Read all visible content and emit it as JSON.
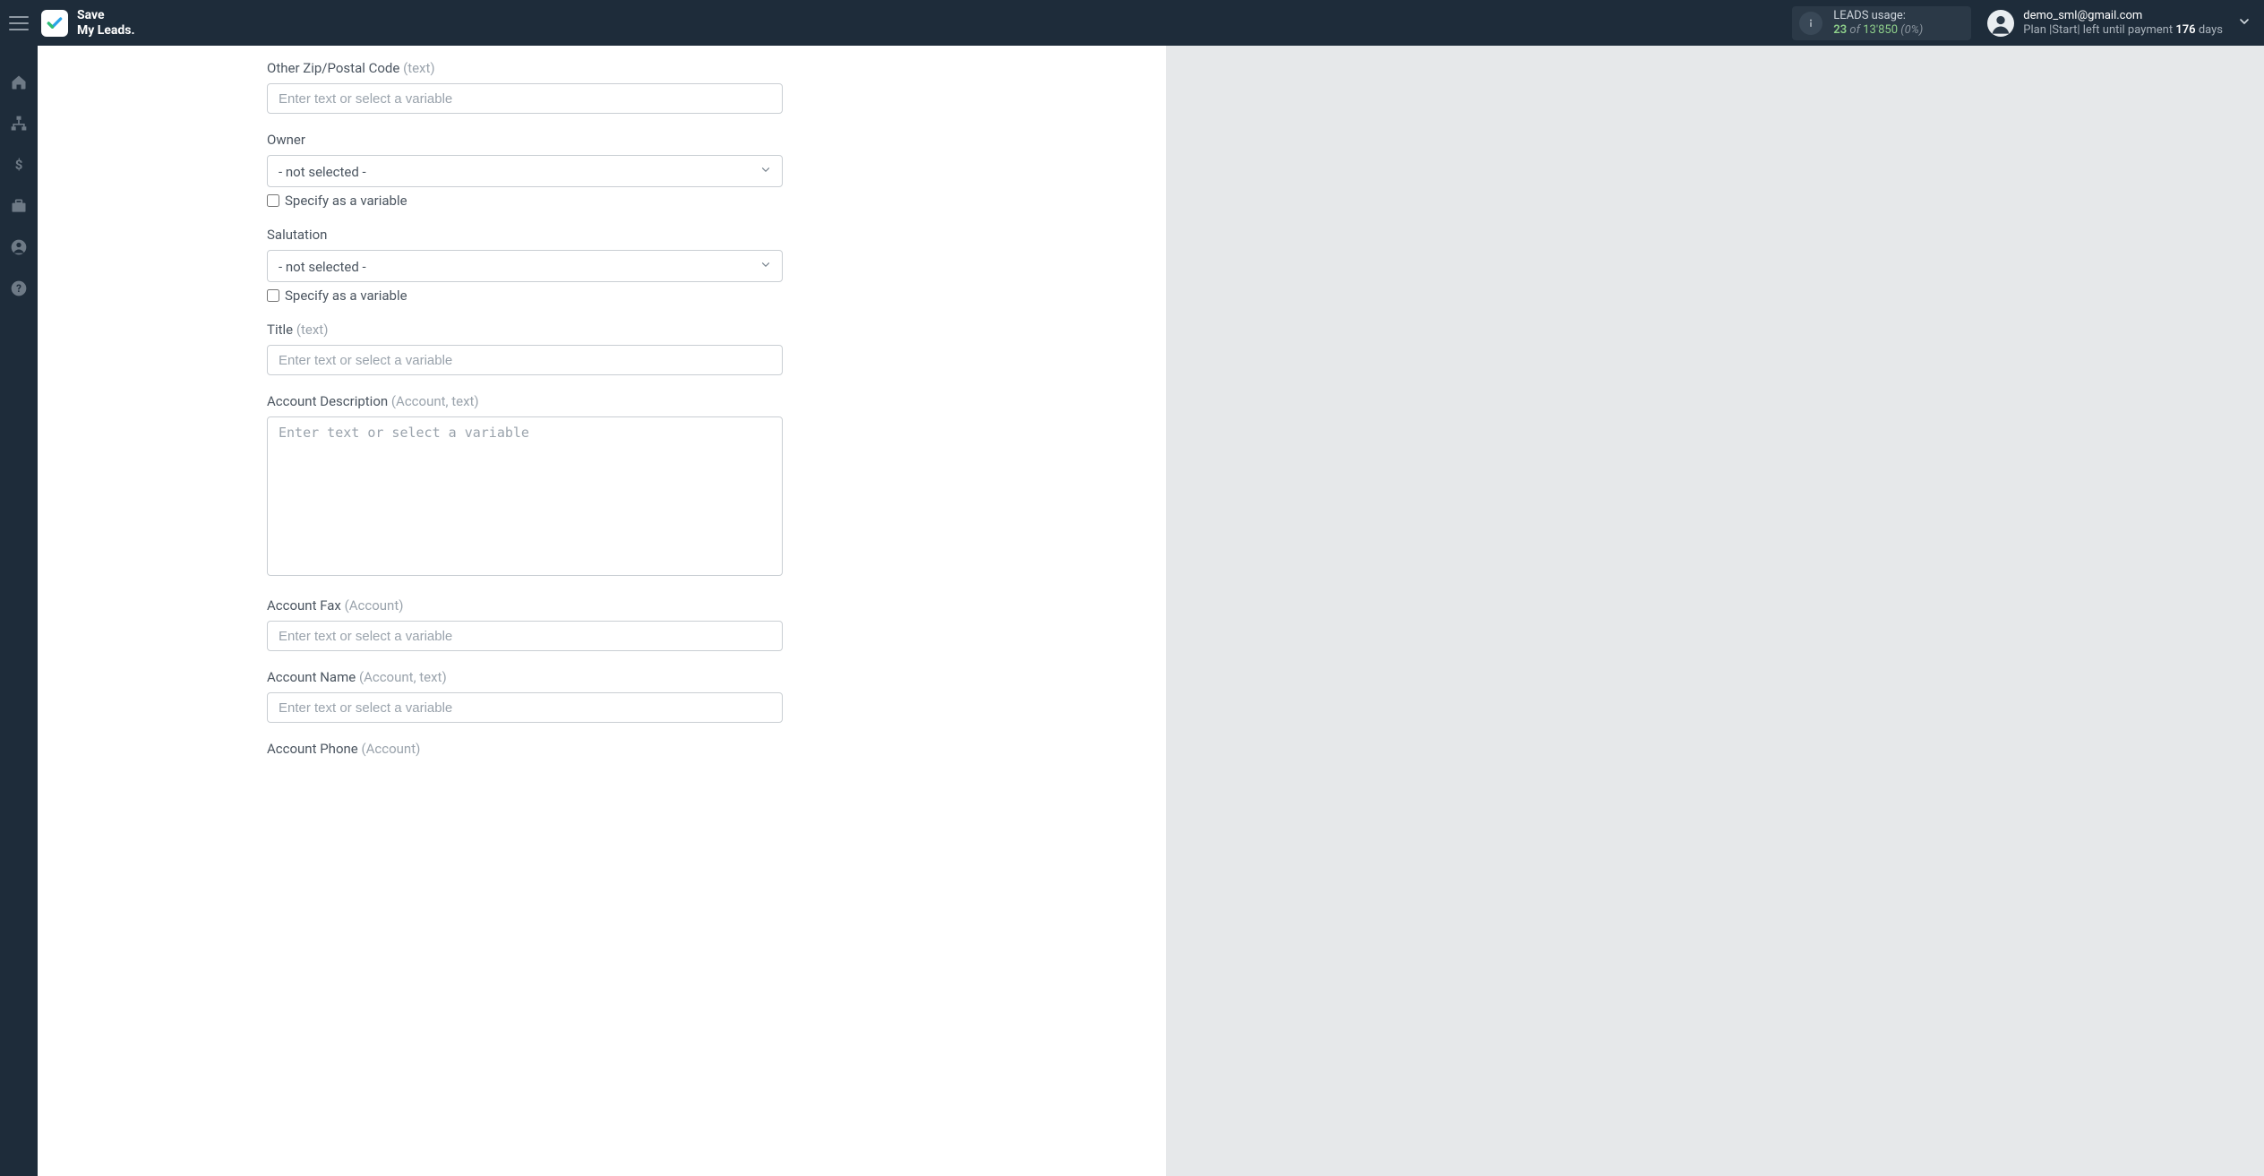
{
  "brand": {
    "line1": "Save",
    "line2": "My Leads."
  },
  "usage": {
    "label": "LEADS usage:",
    "count": "23",
    "of": "of",
    "total": "13'850",
    "pct": "(0%)"
  },
  "user": {
    "email": "demo_sml@gmail.com",
    "plan_prefix": "Plan |Start| left until payment ",
    "plan_days": "176",
    "plan_suffix": " days"
  },
  "placeholders": {
    "text": "Enter text or select a variable",
    "not_selected": "- not selected -"
  },
  "labels": {
    "specify_variable": "Specify as a variable"
  },
  "fields": {
    "other_zip": {
      "label": "Other Zip/Postal Code",
      "hint": "(text)"
    },
    "owner": {
      "label": "Owner"
    },
    "salutation": {
      "label": "Salutation"
    },
    "title": {
      "label": "Title",
      "hint": "(text)"
    },
    "account_desc": {
      "label": "Account Description",
      "hint": "(Account, text)"
    },
    "account_fax": {
      "label": "Account Fax",
      "hint": "(Account)"
    },
    "account_name": {
      "label": "Account Name",
      "hint": "(Account, text)"
    },
    "account_phone": {
      "label": "Account Phone",
      "hint": "(Account)"
    }
  }
}
